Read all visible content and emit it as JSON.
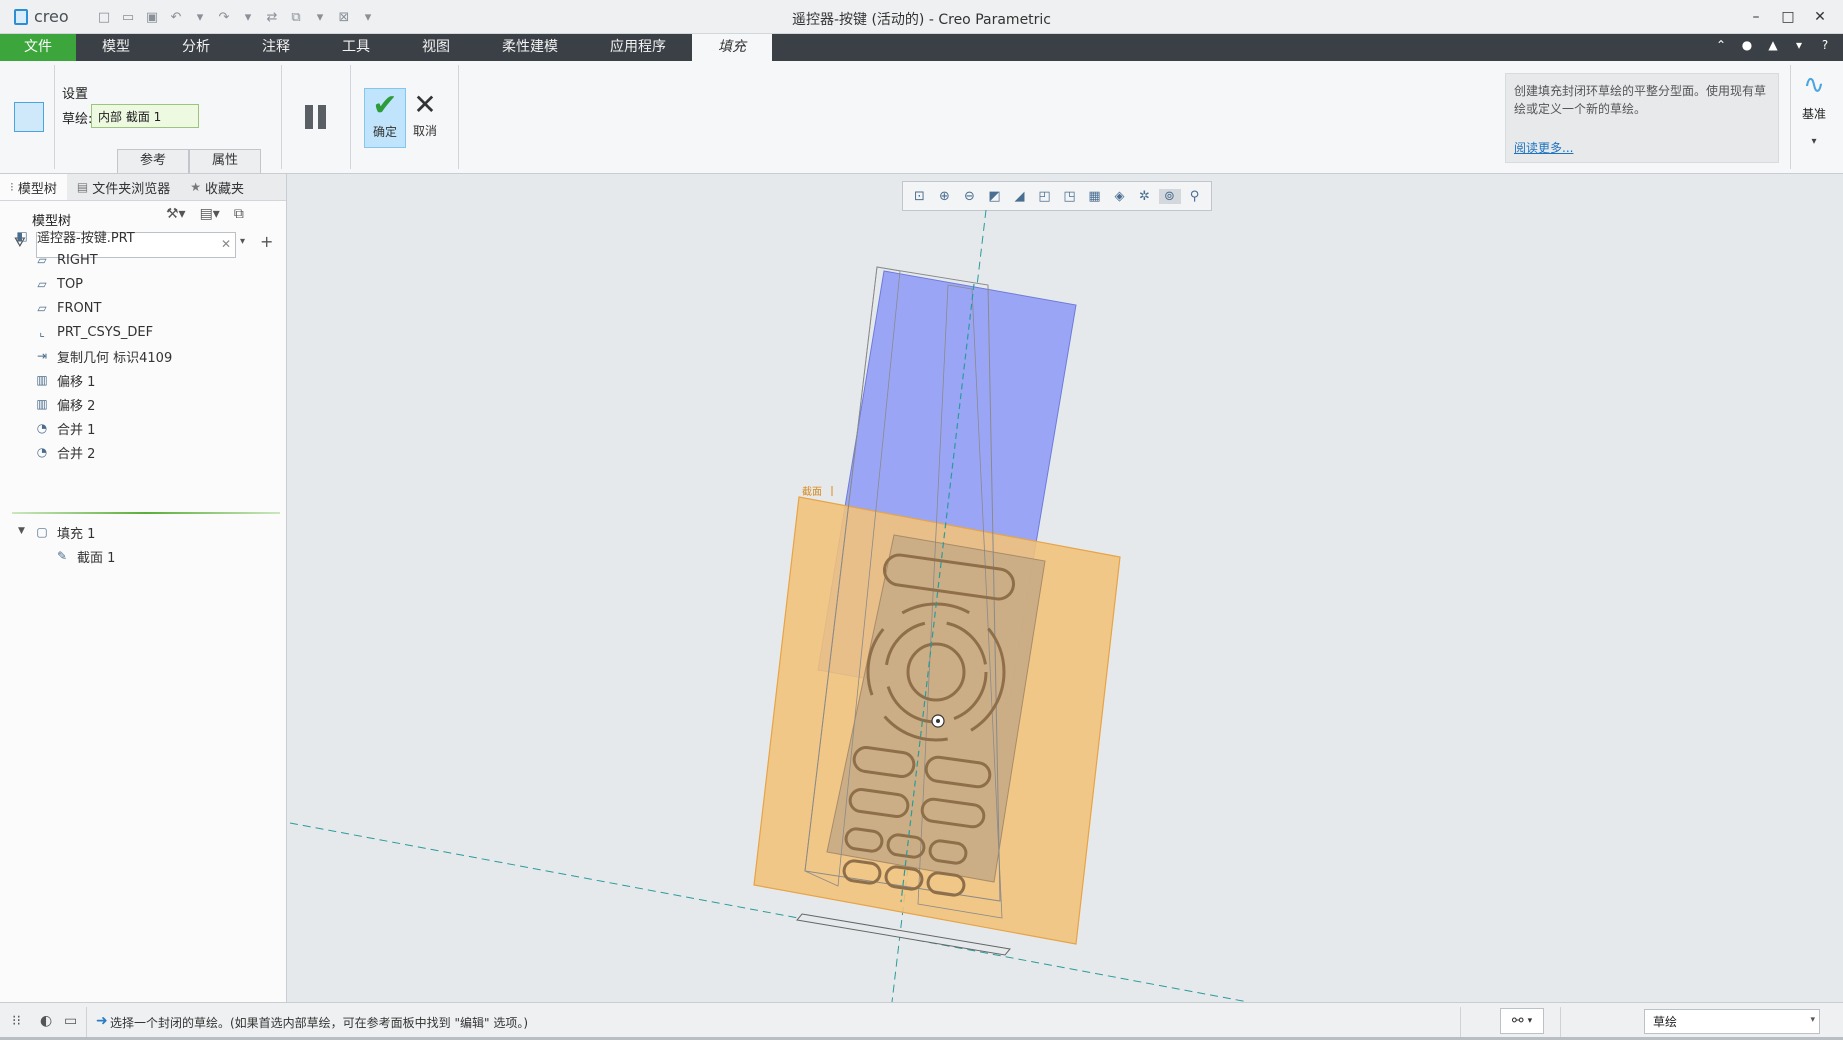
{
  "app": {
    "logo_text": "creo",
    "window_title": "遥控器-按键 (活动的) - Creo Parametric"
  },
  "ribbon_tabs": [
    "文件",
    "模型",
    "分析",
    "注释",
    "工具",
    "视图",
    "柔性建模",
    "应用程序",
    "填充"
  ],
  "ribbon": {
    "settings_title": "设置",
    "sketch_label": "草绘:",
    "sketch_value": "内部 截面 1",
    "panel_tabs": [
      "参考",
      "属性"
    ],
    "ok_label": "确定",
    "cancel_label": "取消",
    "help_text": "创建填充封闭环草绘的平整分型面。使用现有草绘或定义一个新的草绘。",
    "help_link": "阅读更多...",
    "datum_label": "基准"
  },
  "left_panel": {
    "tabs": [
      "模型树",
      "文件夹浏览器",
      "收藏夹"
    ],
    "header": "模型树",
    "search_placeholder": "",
    "tree": [
      {
        "label": "遥控器-按键.PRT",
        "icon": "part-icon"
      },
      {
        "label": "RIGHT",
        "icon": "datum-plane-icon"
      },
      {
        "label": "TOP",
        "icon": "datum-plane-icon"
      },
      {
        "label": "FRONT",
        "icon": "datum-plane-icon"
      },
      {
        "label": "PRT_CSYS_DEF",
        "icon": "csys-icon"
      },
      {
        "label": "复制几何 标识4109",
        "icon": "copy-geom-icon"
      },
      {
        "label": "偏移 1",
        "icon": "offset-icon"
      },
      {
        "label": "偏移 2",
        "icon": "offset-icon"
      },
      {
        "label": "合并 1",
        "icon": "merge-icon"
      },
      {
        "label": "合并 2",
        "icon": "merge-icon"
      },
      {
        "label": "填充 1",
        "icon": "fill-icon"
      },
      {
        "label": "截面 1",
        "icon": "sketch-icon"
      }
    ]
  },
  "canvas": {
    "plane_tag": "截面"
  },
  "status": {
    "message": "选择一个封闭的草绘。(如果首选内部草绘，可在参考面板中找到 \"编辑\" 选项。)",
    "filter_value": "草绘"
  },
  "colors": {
    "accent": "#3ca53c",
    "fill_surface": "#f2c27a",
    "blue_surface": "#9aa6f5",
    "part_body": "#c9a87e"
  }
}
